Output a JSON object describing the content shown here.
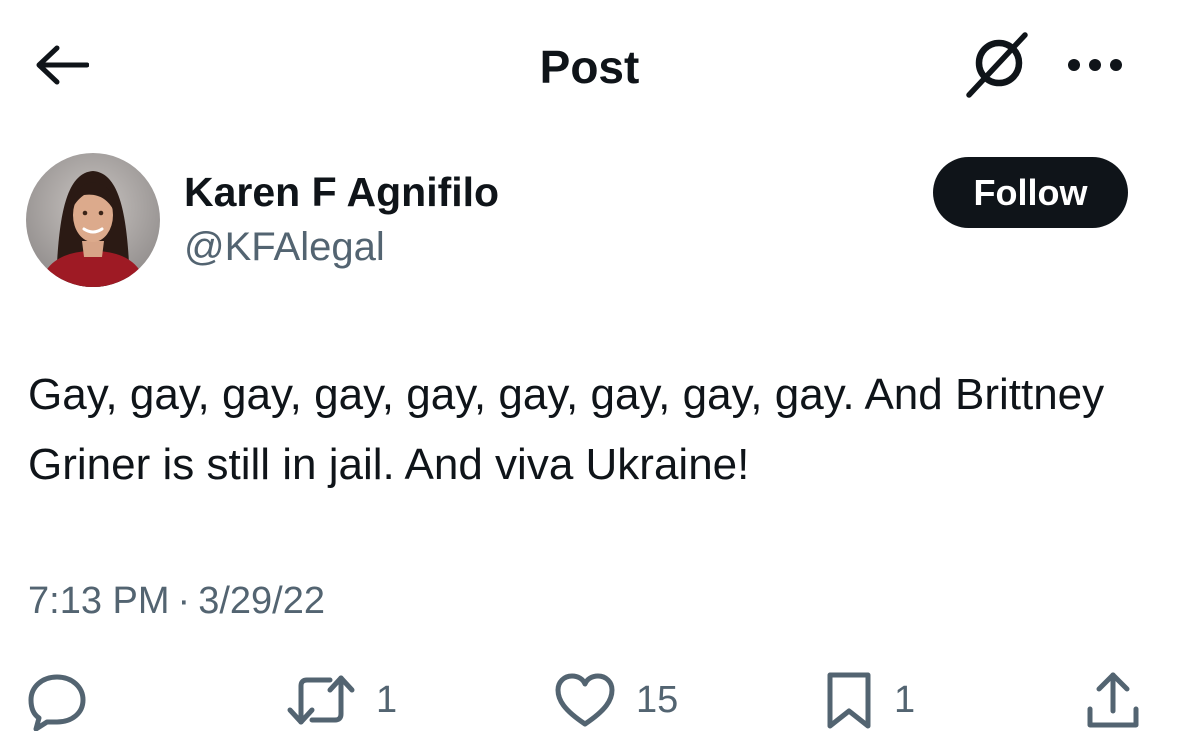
{
  "header": {
    "title": "Post",
    "back_icon": "arrow-left-icon",
    "grok_icon": "grok-icon",
    "more_icon": "more-horizontal-icon"
  },
  "author": {
    "display_name": "Karen F Agnifilo",
    "handle": "@KFAlegal",
    "follow_label": "Follow"
  },
  "tweet": {
    "text": "Gay, gay, gay, gay, gay, gay, gay, gay, gay. And Brittney Griner is still in jail. And viva Ukraine!",
    "time": "7:13 PM",
    "separator": "·",
    "date": "3/29/22"
  },
  "actions": {
    "reply": {
      "icon": "reply-icon",
      "count": ""
    },
    "repost": {
      "icon": "repost-icon",
      "count": "1"
    },
    "like": {
      "icon": "heart-icon",
      "count": "15"
    },
    "bookmark": {
      "icon": "bookmark-icon",
      "count": "1"
    },
    "share": {
      "icon": "share-icon",
      "count": ""
    }
  },
  "colors": {
    "text": "#0f1419",
    "secondary": "#536471",
    "follow_bg": "#0f1419",
    "follow_text": "#ffffff",
    "background": "#ffffff"
  }
}
